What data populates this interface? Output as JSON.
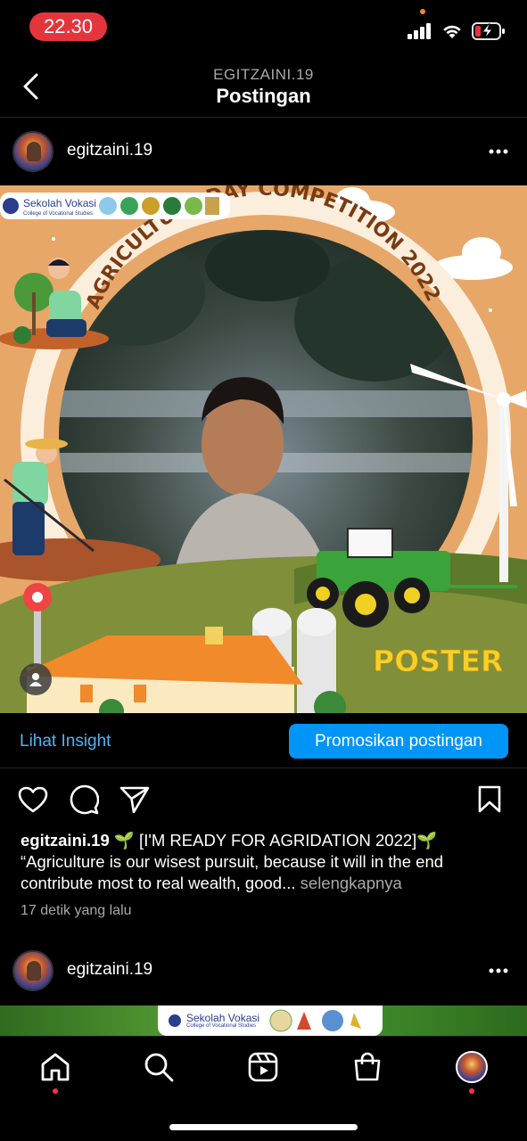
{
  "status": {
    "time": "22.30",
    "icons": [
      "cellular-icon",
      "wifi-icon",
      "battery-low-charging-icon"
    ],
    "accent": "#e5353c"
  },
  "header": {
    "subtitle": "EGITZAINI.19",
    "title": "Postingan"
  },
  "post": {
    "username": "egitzaini.19",
    "poster": {
      "banner_title": "Sekolah Vokasi",
      "banner_subtitle": "College of Vocational Studies",
      "heading": "AGRICULTURE DAY COMPETITION 2022",
      "category": "POSTER"
    },
    "insight_label": "Lihat Insight",
    "promote_label": "Promosikan postingan",
    "caption_user": "egitzaini.19",
    "caption_line1": "🌱 [I'M READY FOR AGRIDATION 2022]🌱",
    "caption_line2": "“Agriculture is our wisest pursuit, because it will in the end contribute most to real wealth, good...",
    "more_label": "selengkapnya",
    "timestamp": "17 detik yang lalu"
  },
  "post2": {
    "username": "egitzaini.19",
    "banner_title": "Sekolah Vokasi",
    "banner_subtitle": "College of Vocational Studies"
  },
  "colors": {
    "link": "#4db5f9",
    "button": "#0095f6",
    "notification": "#ff3040",
    "poster_bg": "#e7a769"
  },
  "nav": [
    "home-icon",
    "search-icon",
    "reels-icon",
    "shop-icon",
    "profile-avatar"
  ]
}
